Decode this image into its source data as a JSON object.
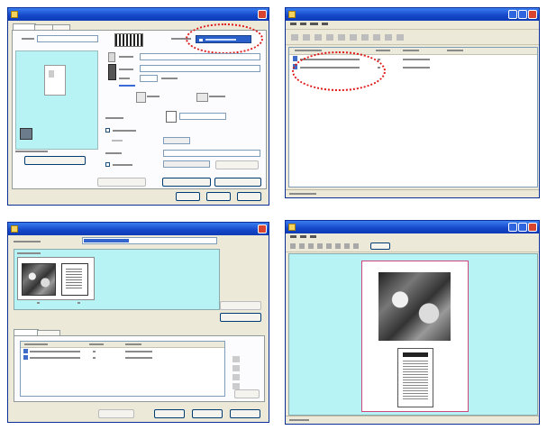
{
  "colors": {
    "titlebar": "#1446c8",
    "canvas_cyan": "#b7f3f4",
    "highlight_red": "#e01818",
    "window_face": "#ece9d8"
  },
  "icons": {
    "app": "printer-icon",
    "close": "close-icon",
    "minimize": "minimize-icon",
    "maximize": "maximize-icon",
    "document": "document-icon"
  }
}
